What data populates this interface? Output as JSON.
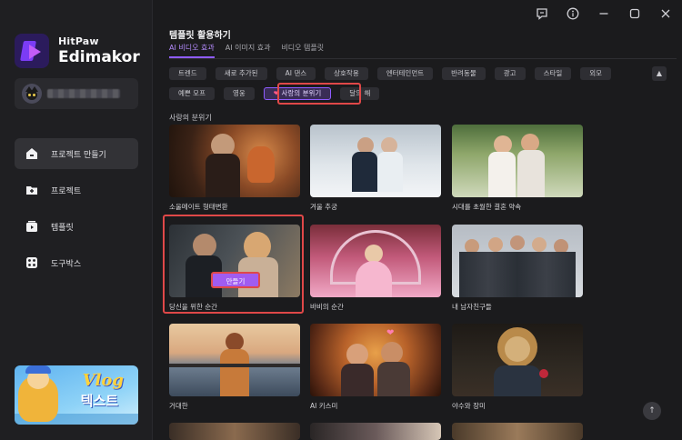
{
  "app": {
    "brand_small": "HitPaw",
    "brand_big": "Edimakor"
  },
  "sidebar": {
    "items": [
      {
        "label": "프로젝트 만들기",
        "icon": "home-icon",
        "active": true
      },
      {
        "label": "프로젝트",
        "icon": "folder-plus-icon",
        "active": false
      },
      {
        "label": "템플릿",
        "icon": "template-icon",
        "active": false
      },
      {
        "label": "도구박스",
        "icon": "toolbox-icon",
        "active": false
      }
    ],
    "promo": {
      "title": "Vlog",
      "subtitle": "텍스트"
    }
  },
  "window": {
    "icons": [
      "feedback-icon",
      "info-icon",
      "minimize-icon",
      "maximize-icon",
      "close-icon"
    ]
  },
  "main": {
    "section_title": "템플릿 활용하기",
    "tabs": [
      {
        "label": "AI 비디오 효과",
        "active": true
      },
      {
        "label": "AI 이미지 효과",
        "active": false
      },
      {
        "label": "비디오 템플릿",
        "active": false
      }
    ],
    "chips_row1": [
      "트렌드",
      "새로 추가된",
      "AI 댄스",
      "상호작용",
      "엔터테인먼트",
      "반려동물",
      "광고",
      "스타일",
      "외모"
    ],
    "chips_row2": [
      "예쁜 모프",
      "영웅",
      "사랑의 분위기",
      "달의 해"
    ],
    "selected_chip": "사랑의 분위기",
    "selected_chip_icon": "heart-icon",
    "subsection_title": "사랑의 분위기",
    "cards": [
      {
        "label": "소울메이트 형태변환"
      },
      {
        "label": "겨울 추궁"
      },
      {
        "label": "시대를 초월한 결혼 약속"
      },
      {
        "label": "당신을 위한 순간"
      },
      {
        "label": "바비의 순간"
      },
      {
        "label": "내 남자친구들"
      },
      {
        "label": "거대한"
      },
      {
        "label": "AI 키스미"
      },
      {
        "label": "야수와 장미"
      }
    ],
    "make_button": "만들기"
  },
  "colors": {
    "accent": "#8f5cff",
    "highlight_border": "#e04848",
    "background": "#1b1b1d"
  }
}
